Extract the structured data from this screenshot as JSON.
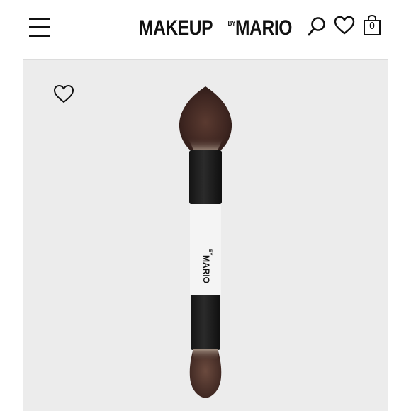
{
  "header": {
    "brand": {
      "main": "MAKEUP",
      "by": "BY",
      "mario": "MARIO"
    },
    "menu_icon": "hamburger-icon",
    "search_icon": "search-icon",
    "wishlist_icon": "heart-icon",
    "bag_icon": "shopping-bag-icon",
    "bag_count": "0"
  },
  "product": {
    "wishlist_icon": "heart-icon",
    "image": {
      "subject": "double-ended makeup brush",
      "handle_text_by": "BY",
      "handle_text_mario": "MARIO"
    }
  },
  "colors": {
    "background": "#ececec",
    "frame": "#ffffff",
    "text": "#111111",
    "brush_handle": "#1c1c1c",
    "brush_band": "#f2f2f2",
    "bristle": "#4a2e26"
  }
}
